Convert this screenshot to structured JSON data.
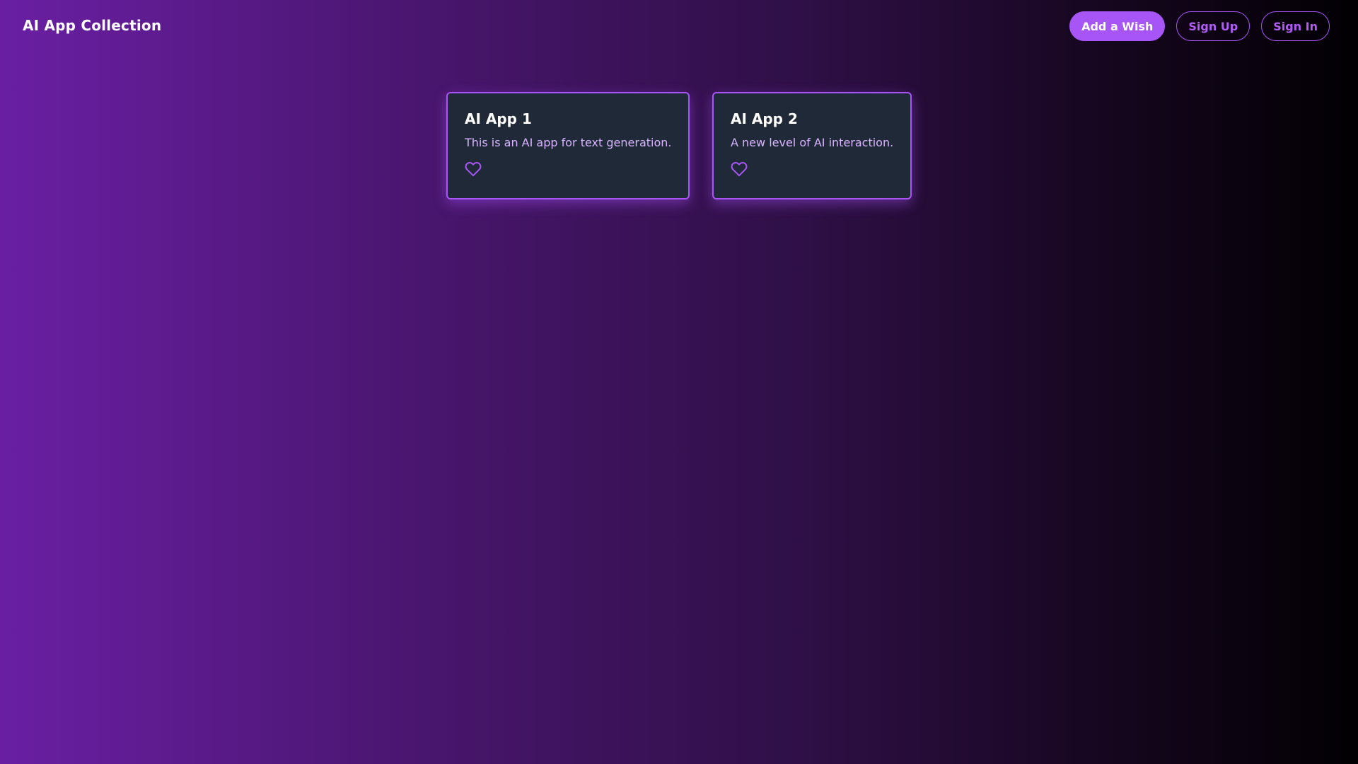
{
  "header": {
    "brand": "AI App Collection",
    "buttons": {
      "add_wish": "Add a Wish",
      "sign_up": "Sign Up",
      "sign_in": "Sign In"
    }
  },
  "apps": [
    {
      "title": "AI App 1",
      "description": "This is an AI app for text generation.",
      "favorite_icon": "heart-outline-icon"
    },
    {
      "title": "AI App 2",
      "description": "A new level of AI interaction.",
      "favorite_icon": "heart-outline-icon"
    }
  ],
  "colors": {
    "accent": "#a855f7",
    "card_background": "#1f2937",
    "description_text": "#d8b4fe",
    "gradient_start": "#6a1fa3",
    "gradient_end": "#020003"
  }
}
